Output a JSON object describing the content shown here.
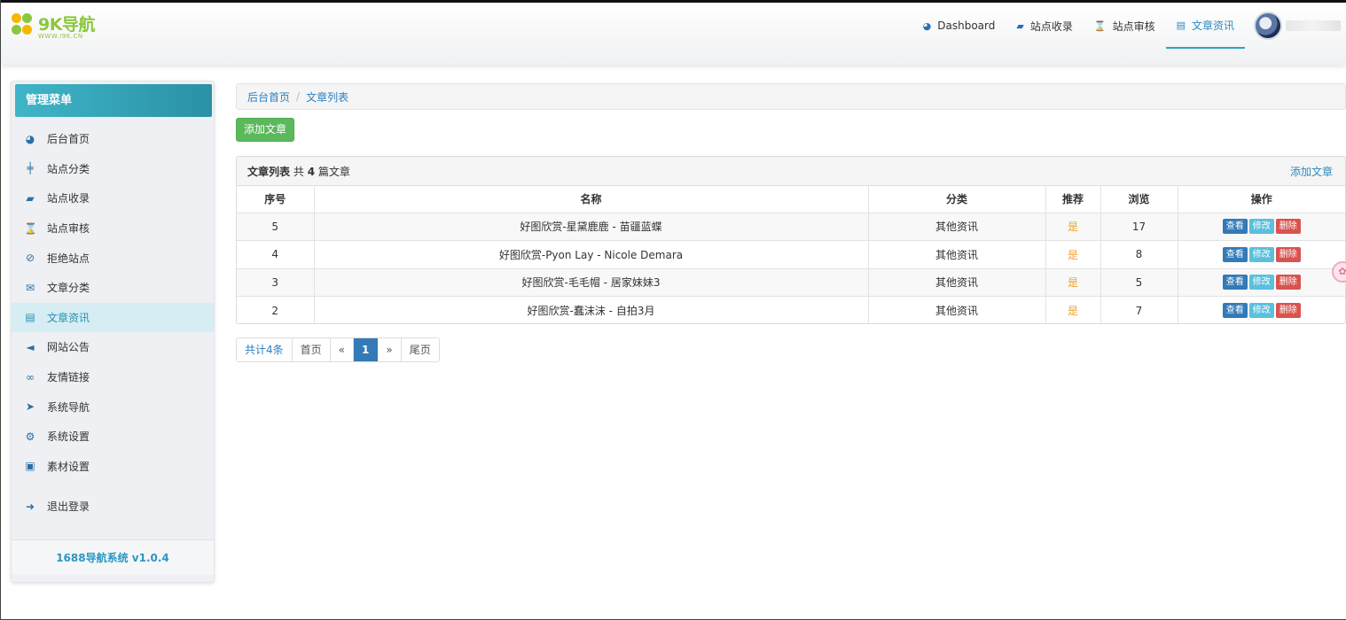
{
  "logo": {
    "text": "9K导航",
    "sub": "WWW.I9K.CN"
  },
  "topnav": [
    {
      "icon": "dashboard-icon",
      "label": "Dashboard",
      "active": false
    },
    {
      "icon": "book-icon",
      "label": "站点收录",
      "active": false
    },
    {
      "icon": "hourglass-icon",
      "label": "站点审核",
      "active": false
    },
    {
      "icon": "newspaper-icon",
      "label": "文章资讯",
      "active": true
    }
  ],
  "sidebar": {
    "title": "管理菜单",
    "items": [
      {
        "icon": "dashboard-icon",
        "label": "后台首页"
      },
      {
        "icon": "signpost-icon",
        "label": "站点分类"
      },
      {
        "icon": "book-icon",
        "label": "站点收录"
      },
      {
        "icon": "hourglass-icon",
        "label": "站点审核"
      },
      {
        "icon": "ban-icon",
        "label": "拒绝站点"
      },
      {
        "icon": "envelope-icon",
        "label": "文章分类"
      },
      {
        "icon": "newspaper-icon",
        "label": "文章资讯",
        "active": true
      },
      {
        "icon": "bullhorn-icon",
        "label": "网站公告"
      },
      {
        "icon": "handshake-icon",
        "label": "友情链接"
      },
      {
        "icon": "location-arrow-icon",
        "label": "系统导航"
      },
      {
        "icon": "gear-icon",
        "label": "系统设置"
      },
      {
        "icon": "image-icon",
        "label": "素材设置"
      }
    ],
    "logout": {
      "icon": "sign-out-icon",
      "label": "退出登录"
    },
    "footer": "1688导航系统 v1.0.4"
  },
  "breadcrumb": {
    "home": "后台首页",
    "sep": "/",
    "current": "文章列表"
  },
  "add_button": "添加文章",
  "panel": {
    "title": "文章列表",
    "summary_prefix": "共",
    "count": "4",
    "summary_suffix": "篇文章",
    "link": "添加文章"
  },
  "table": {
    "headers": [
      "序号",
      "名称",
      "分类",
      "推荐",
      "浏览",
      "操作"
    ],
    "rows": [
      {
        "id": "5",
        "name": "好图欣赏-星黛鹿鹿 - 苗疆蓝蝶",
        "category": "其他资讯",
        "recommend": "是",
        "views": "17"
      },
      {
        "id": "4",
        "name": "好图欣赏-Pyon Lay - Nicole Demara",
        "category": "其他资讯",
        "recommend": "是",
        "views": "8"
      },
      {
        "id": "3",
        "name": "好图欣赏-毛毛帽 - 居家妹妹3",
        "category": "其他资讯",
        "recommend": "是",
        "views": "5"
      },
      {
        "id": "2",
        "name": "好图欣赏-蠢沫沫 - 自拍3月",
        "category": "其他资讯",
        "recommend": "是",
        "views": "7"
      }
    ],
    "actions": {
      "view": "查看",
      "edit": "修改",
      "delete": "删除"
    }
  },
  "pager": {
    "total": "共计4条",
    "first": "首页",
    "prev": "«",
    "current": "1",
    "next": "»",
    "last": "尾页"
  },
  "colors": {
    "accent": "#2b91a5",
    "success": "#5cb85c",
    "primary": "#337ab7",
    "info": "#5bc0de",
    "danger": "#d9534f",
    "recommend": "#f0a030"
  }
}
